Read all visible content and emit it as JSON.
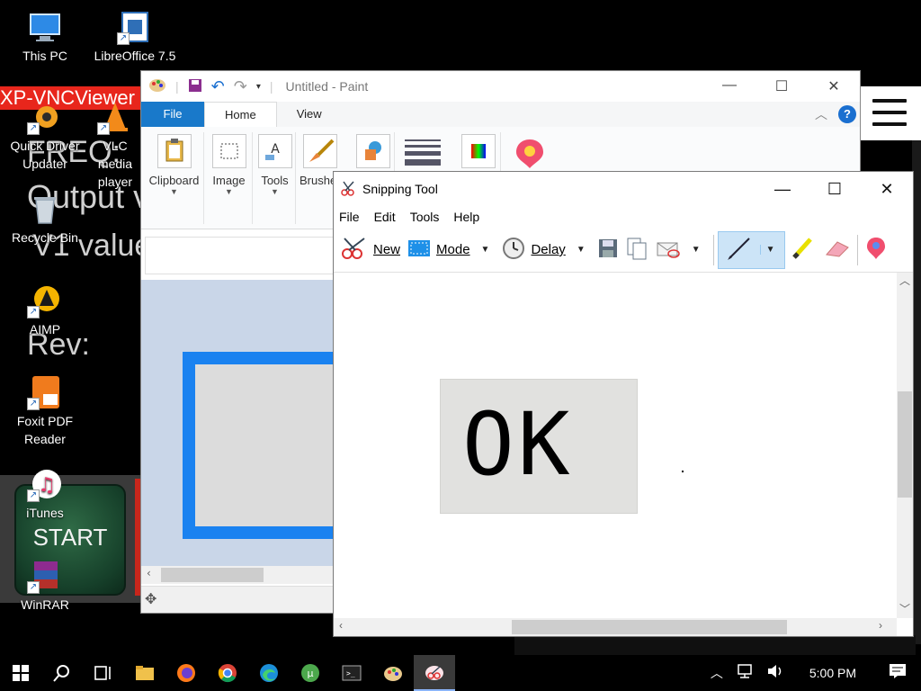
{
  "background_app": {
    "vnc_title": "XP-VNCViewer",
    "freq_text": "FREQ:",
    "output_text": "Output v",
    "v1_text": "V1 value",
    "rev_text": "Rev:",
    "start_label": "START"
  },
  "desktop_icons": [
    {
      "label": "This PC"
    },
    {
      "label": "LibreOffice 7.5"
    },
    {
      "label": "Quick Driver Updater"
    },
    {
      "label": "VLC media player"
    },
    {
      "label": "Recycle Bin"
    },
    {
      "label": "AIMP"
    },
    {
      "label": "Foxit PDF Reader"
    },
    {
      "label": "iTunes"
    },
    {
      "label": "WinRAR"
    }
  ],
  "paint": {
    "title": "Untitled - Paint",
    "tabs": [
      "File",
      "Home",
      "View"
    ],
    "groups": [
      "Clipboard",
      "Image",
      "Tools",
      "Brushes"
    ],
    "help": "?"
  },
  "snipping_tool": {
    "title": "Snipping Tool",
    "menu": [
      "File",
      "Edit",
      "Tools",
      "Help"
    ],
    "new_label": "New",
    "mode_label": "Mode",
    "delay_label": "Delay",
    "capture_text": "OK"
  },
  "taskbar": {
    "clock": "5:00 PM"
  },
  "colors": {
    "paint_accent": "#1979ca",
    "paint_frame_blue": "#1a82f0",
    "vnc_red": "#e8261c",
    "start_green": "#16402a",
    "pen_highlight": "#cce4f7"
  }
}
